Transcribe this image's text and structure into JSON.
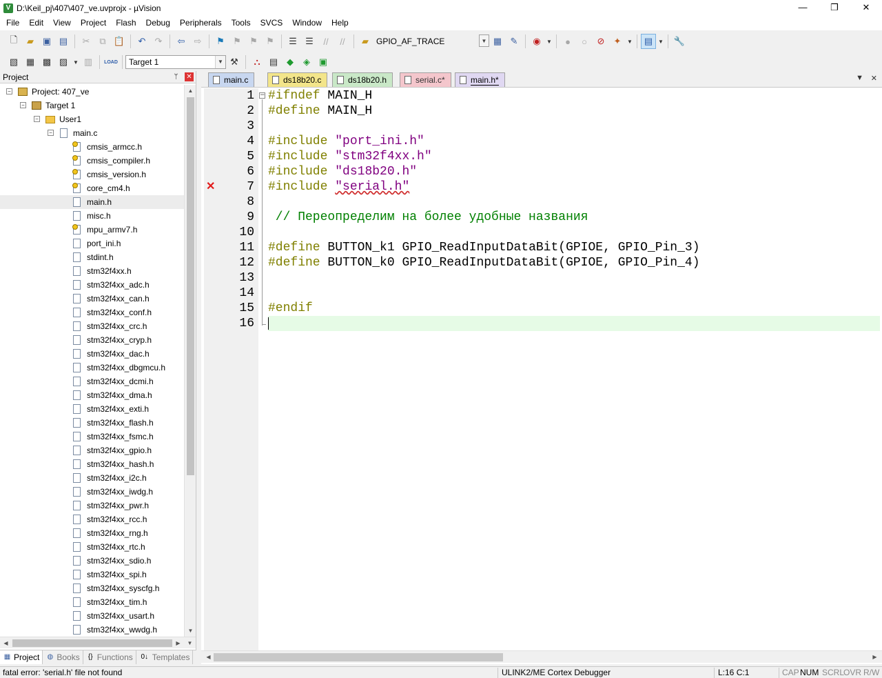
{
  "window": {
    "title": "D:\\Keil_pj\\407\\407_ve.uvprojx - µVision",
    "app_icon": "V",
    "minimize": "—",
    "maximize": "❐",
    "close": "✕"
  },
  "menu": [
    "File",
    "Edit",
    "View",
    "Project",
    "Flash",
    "Debug",
    "Peripherals",
    "Tools",
    "SVCS",
    "Window",
    "Help"
  ],
  "toolbar1": {
    "find_combo_value": "GPIO_AF_TRACE"
  },
  "toolbar2": {
    "load_label": "LOAD",
    "target_combo_value": "Target 1"
  },
  "project_panel": {
    "header": "Project",
    "pin": "ᛘ",
    "close": "✕",
    "tree": {
      "project": "Project: 407_ve",
      "target": "Target 1",
      "group": "User1",
      "source": "main.c",
      "headers": [
        {
          "name": "cmsis_armcc.h",
          "icon": "file-key-icon"
        },
        {
          "name": "cmsis_compiler.h",
          "icon": "file-key-icon"
        },
        {
          "name": "cmsis_version.h",
          "icon": "file-key-icon"
        },
        {
          "name": "core_cm4.h",
          "icon": "file-key-icon"
        },
        {
          "name": "main.h",
          "icon": "file-icon"
        },
        {
          "name": "misc.h",
          "icon": "file-icon"
        },
        {
          "name": "mpu_armv7.h",
          "icon": "file-key-icon"
        },
        {
          "name": "port_ini.h",
          "icon": "file-icon"
        },
        {
          "name": "stdint.h",
          "icon": "file-icon"
        },
        {
          "name": "stm32f4xx.h",
          "icon": "file-icon"
        },
        {
          "name": "stm32f4xx_adc.h",
          "icon": "file-icon"
        },
        {
          "name": "stm32f4xx_can.h",
          "icon": "file-icon"
        },
        {
          "name": "stm32f4xx_conf.h",
          "icon": "file-icon"
        },
        {
          "name": "stm32f4xx_crc.h",
          "icon": "file-icon"
        },
        {
          "name": "stm32f4xx_cryp.h",
          "icon": "file-icon"
        },
        {
          "name": "stm32f4xx_dac.h",
          "icon": "file-icon"
        },
        {
          "name": "stm32f4xx_dbgmcu.h",
          "icon": "file-icon"
        },
        {
          "name": "stm32f4xx_dcmi.h",
          "icon": "file-icon"
        },
        {
          "name": "stm32f4xx_dma.h",
          "icon": "file-icon"
        },
        {
          "name": "stm32f4xx_exti.h",
          "icon": "file-icon"
        },
        {
          "name": "stm32f4xx_flash.h",
          "icon": "file-icon"
        },
        {
          "name": "stm32f4xx_fsmc.h",
          "icon": "file-icon"
        },
        {
          "name": "stm32f4xx_gpio.h",
          "icon": "file-icon"
        },
        {
          "name": "stm32f4xx_hash.h",
          "icon": "file-icon"
        },
        {
          "name": "stm32f4xx_i2c.h",
          "icon": "file-icon"
        },
        {
          "name": "stm32f4xx_iwdg.h",
          "icon": "file-icon"
        },
        {
          "name": "stm32f4xx_pwr.h",
          "icon": "file-icon"
        },
        {
          "name": "stm32f4xx_rcc.h",
          "icon": "file-icon"
        },
        {
          "name": "stm32f4xx_rng.h",
          "icon": "file-icon"
        },
        {
          "name": "stm32f4xx_rtc.h",
          "icon": "file-icon"
        },
        {
          "name": "stm32f4xx_sdio.h",
          "icon": "file-icon"
        },
        {
          "name": "stm32f4xx_spi.h",
          "icon": "file-icon"
        },
        {
          "name": "stm32f4xx_syscfg.h",
          "icon": "file-icon"
        },
        {
          "name": "stm32f4xx_tim.h",
          "icon": "file-icon"
        },
        {
          "name": "stm32f4xx_usart.h",
          "icon": "file-icon"
        },
        {
          "name": "stm32f4xx_wwdg.h",
          "icon": "file-icon"
        }
      ],
      "selected": "main.h"
    },
    "tabs": [
      {
        "label": "Project",
        "icon": "project-icon",
        "glyph": "▦"
      },
      {
        "label": "Books",
        "icon": "books-icon",
        "glyph": "◍"
      },
      {
        "label": "Functions",
        "icon": "functions-icon",
        "glyph": "{}"
      },
      {
        "label": "Templates",
        "icon": "templates-icon",
        "glyph": "0↓"
      }
    ]
  },
  "editor": {
    "tabs": [
      {
        "label": "main.c",
        "color": "#c8d7f0"
      },
      {
        "label": "ds18b20.c",
        "color": "#f3e58a"
      },
      {
        "label": "ds18b20.h",
        "color": "#c9e8c7"
      },
      {
        "label": "serial.c*",
        "color": "#f4c6cc"
      },
      {
        "label": "main.h*",
        "color": "#e0d8f2",
        "active": true
      }
    ],
    "tab_menu": "▼",
    "tab_close": "✕",
    "lines": [
      {
        "n": "1",
        "kw": "#ifndef",
        "rest": " MAIN_H"
      },
      {
        "n": "2",
        "kw": "#define",
        "rest": " MAIN_H"
      },
      {
        "n": "3"
      },
      {
        "n": "4",
        "kw": "#include",
        "str": "\"port_ini.h\""
      },
      {
        "n": "5",
        "kw": "#include",
        "str": "\"stm32f4xx.h\""
      },
      {
        "n": "6",
        "kw": "#include",
        "str": "\"ds18b20.h\""
      },
      {
        "n": "7",
        "kw": "#include",
        "str": "\"serial.h\"",
        "error": true
      },
      {
        "n": "8"
      },
      {
        "n": "9",
        "comment": " // Переопределим на более удобные названия"
      },
      {
        "n": "10"
      },
      {
        "n": "11",
        "kw": "#define",
        "rest": " BUTTON_k1 GPIO_ReadInputDataBit(GPIOE, GPIO_Pin_3)"
      },
      {
        "n": "12",
        "kw": "#define",
        "rest": " BUTTON_k0 GPIO_ReadInputDataBit(GPIOE, GPIO_Pin_4)"
      },
      {
        "n": "13"
      },
      {
        "n": "14"
      },
      {
        "n": "15",
        "kw": "#endif"
      },
      {
        "n": "16",
        "current": true
      }
    ],
    "error_glyph": "✕"
  },
  "status": {
    "message": "fatal error: 'serial.h' file not found",
    "debugger": "ULINK2/ME Cortex Debugger",
    "position": "L:16 C:1",
    "cap": "CAP",
    "num": "NUM",
    "scrl": "SCRL",
    "ovr": "OVR",
    "rw": "R/W"
  },
  "colors": {
    "preprocessor": "#808000",
    "string": "#800080",
    "comment": "#008000",
    "error": "#e21b1b",
    "current_line": "#e6fbe6"
  }
}
